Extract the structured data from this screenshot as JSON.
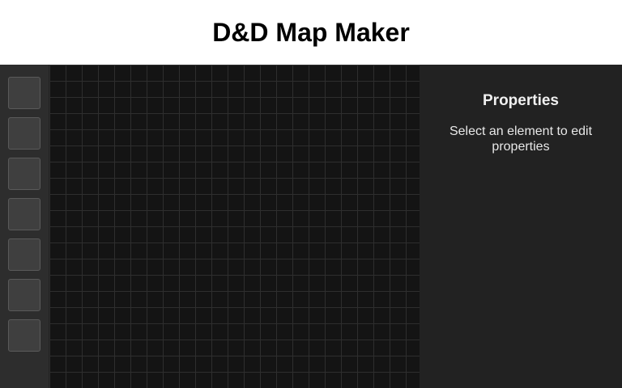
{
  "header": {
    "title": "D&D Map Maker"
  },
  "toolbar": {
    "tools": [
      {
        "icon": "unknown-tool-icon",
        "glyph": ""
      },
      {
        "icon": "unknown-tool-icon",
        "glyph": ""
      },
      {
        "icon": "unknown-tool-icon",
        "glyph": ""
      },
      {
        "icon": "unknown-tool-icon",
        "glyph": ""
      },
      {
        "icon": "unknown-tool-icon",
        "glyph": ""
      },
      {
        "icon": "unknown-tool-icon",
        "glyph": ""
      },
      {
        "icon": "unknown-tool-icon",
        "glyph": ""
      }
    ]
  },
  "properties": {
    "title": "Properties",
    "empty_message": "Select an element to edit properties"
  },
  "colors": {
    "canvas_background": "#141414",
    "grid_line": "#2e2e2e",
    "toolbar_background": "#2d2d2d",
    "panel_background": "#222222"
  }
}
